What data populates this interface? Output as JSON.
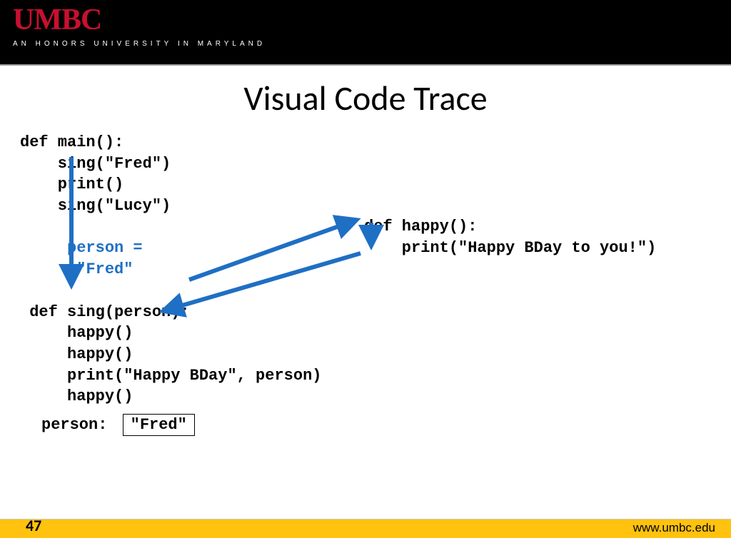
{
  "header": {
    "logo": "UMBC",
    "tagline": "AN HONORS UNIVERSITY IN MARYLAND"
  },
  "title": "Visual Code Trace",
  "code": {
    "main_def": "def main():",
    "main_l1": "    sing(\"Fred\")",
    "main_l2": "    print()",
    "main_l3": "    sing(\"Lucy\")",
    "assign_l1": "     person =",
    "assign_l2": "      \"Fred\"",
    "sing_def": " def sing(person):",
    "sing_l1": "     happy()",
    "sing_l2": "     happy()",
    "sing_l3": "     print(\"Happy BDay\", person)",
    "sing_l4": "     happy()",
    "happy_def": "def happy():",
    "happy_l1": "    print(\"Happy BDay to you!\")"
  },
  "person": {
    "label": "person:",
    "value": "\"Fred\""
  },
  "footer": {
    "page": "47",
    "url": "www.umbc.edu"
  }
}
